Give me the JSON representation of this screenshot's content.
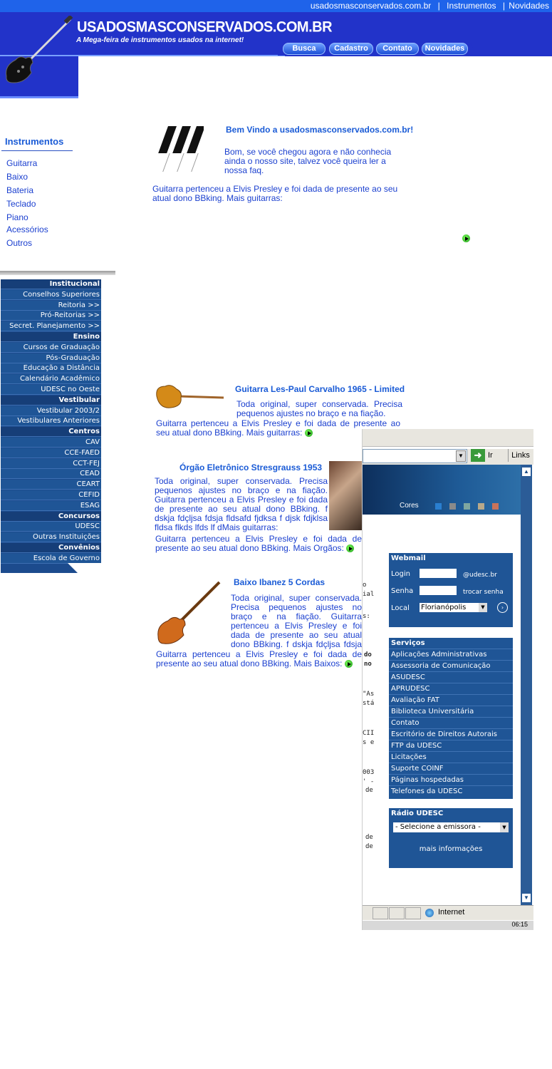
{
  "top_links": {
    "site": "usadosmasconservados.com.br",
    "instrumentos": "Instrumentos",
    "novidades": "Novidades",
    "sep": "|"
  },
  "header": {
    "title": "USADOSMASCONSERVADOS.COM.BR",
    "subtitle": "A Mega-feira de instrumentos usados na internet!",
    "nav": [
      "Busca",
      "Cadastro",
      "Contato",
      "Novidades"
    ]
  },
  "instrumentos": {
    "title": "Instrumentos",
    "items": [
      "Guitarra",
      "Baixo",
      "Bateria",
      "Teclado",
      "Piano",
      "Acessórios",
      "Outros"
    ]
  },
  "udesc_menu": [
    {
      "label": "Institucional",
      "head": true
    },
    {
      "label": "Conselhos Superiores",
      "head": false
    },
    {
      "label": "Reitoria >>",
      "head": false
    },
    {
      "label": "Pró-Reitorias >>",
      "head": false
    },
    {
      "label": "Secret. Planejamento >>",
      "head": false
    },
    {
      "label": "Ensino",
      "head": true
    },
    {
      "label": "Cursos de Graduação",
      "head": false
    },
    {
      "label": "Pós-Graduação",
      "head": false
    },
    {
      "label": "Educação a Distância",
      "head": false
    },
    {
      "label": "Calendário Acadêmico",
      "head": false
    },
    {
      "label": "UDESC no Oeste",
      "head": false
    },
    {
      "label": "Vestibular",
      "head": true
    },
    {
      "label": "Vestibular 2003/2",
      "head": false
    },
    {
      "label": "Vestibulares Anteriores",
      "head": false
    },
    {
      "label": "Centros",
      "head": true
    },
    {
      "label": "CAV",
      "head": false
    },
    {
      "label": "CCE-FAED",
      "head": false
    },
    {
      "label": "CCT-FEJ",
      "head": false
    },
    {
      "label": "CEAD",
      "head": false
    },
    {
      "label": "CEART",
      "head": false
    },
    {
      "label": "CEFID",
      "head": false
    },
    {
      "label": "ESAG",
      "head": false
    },
    {
      "label": "Concursos",
      "head": true
    },
    {
      "label": "UDESC",
      "head": false
    },
    {
      "label": "Outras Instituições",
      "head": false
    },
    {
      "label": "Convênios",
      "head": true
    },
    {
      "label": "Escola de Governo",
      "head": false
    }
  ],
  "welcome": {
    "title": "Bem Vindo a usadosmasconservados.com.br!",
    "text": "Bom, se você chegou agora e não conhecia ainda o nosso site, talvez você queira ler a nossa faq.",
    "intro": "Guitarra pertenceu a Elvis Presley e foi dada de presente ao seu atual dono BBking. Mais guitarras:"
  },
  "products": [
    {
      "title": "Guitarra Les-Paul Carvalho 1965 - Limited",
      "line1": "Toda original, super conservada. Precisa pequenos ajustes no braço e na fiação.",
      "line2": "Guitarra pertenceu a Elvis Presley e foi dada de presente ao seu atual dono BBking. Mais guitarras:"
    },
    {
      "title": "Órgão Eletrônico Stresgrauss 1953",
      "line1": "Toda original, super conservada. Precisa pequenos ajustes no braço e na fiação. Guitarra pertenceu a Elvis Presley e foi dada de presente ao seu atual dono BBking. f dskja fdçljsa fdsja fldsafd fjdksa f djsk fdjklsa fldsa flkds lfds lf dMais guitarras:",
      "line2": "Guitarra pertenceu a Elvis Presley e foi dada de presente ao seu atual dono BBking. Mais Orgãos:"
    },
    {
      "title": "Baixo Ibanez 5 Cordas",
      "line1": "Toda original, super conservada. Precisa pequenos ajustes no braço e na fiação. Guitarra pertenceu a Elvis Presley e foi dada de presente ao seu atual dono BBking. f dskja fdçljsa fdsja fldsafd djsk fdjklsa fldsa flkds lfds lf dMais",
      "line2": "Guitarra pertenceu a Elvis Presley e foi dada de presente ao seu atual dono BBking. Mais Baixos:"
    }
  ],
  "browser": {
    "go": "Ir",
    "links": "Links",
    "cores": "Cores",
    "swatch_colors": [
      "#2a7fd0",
      "#8a8a8a",
      "#7fa7a0",
      "#b8a98a",
      "#c9735a"
    ],
    "webmail_title": "Webmail",
    "login_label": "Login",
    "login_suffix": "@udesc.br",
    "senha_label": "Senha",
    "trocar_senha": "trocar senha",
    "local_label": "Local",
    "local_value": "Florianópolis",
    "servicos_title": "Serviços",
    "servicos": [
      "Aplicações Administrativas",
      "Assessoria de Comunicação",
      "ASUDESC",
      "APRUDESC",
      "Avaliação FAT",
      "Biblioteca Universitária",
      "Contato",
      "Escritório de Direitos Autorais",
      "FTP da UDESC",
      "Licitações",
      "Suporte COINF",
      "Páginas hospedadas",
      "Telefones da UDESC"
    ],
    "radio_title": "Rádio UDESC",
    "radio_select": "- Selecione a emissora -",
    "mais_info": "mais informações",
    "status_zone": "Internet",
    "taskbar_time": "06:15",
    "fragments": [
      "o",
      "ial",
      "s:",
      "do",
      "no",
      "\"As",
      "stá",
      "CII",
      "s e",
      "003",
      "' -",
      "de",
      "de",
      "de"
    ]
  }
}
